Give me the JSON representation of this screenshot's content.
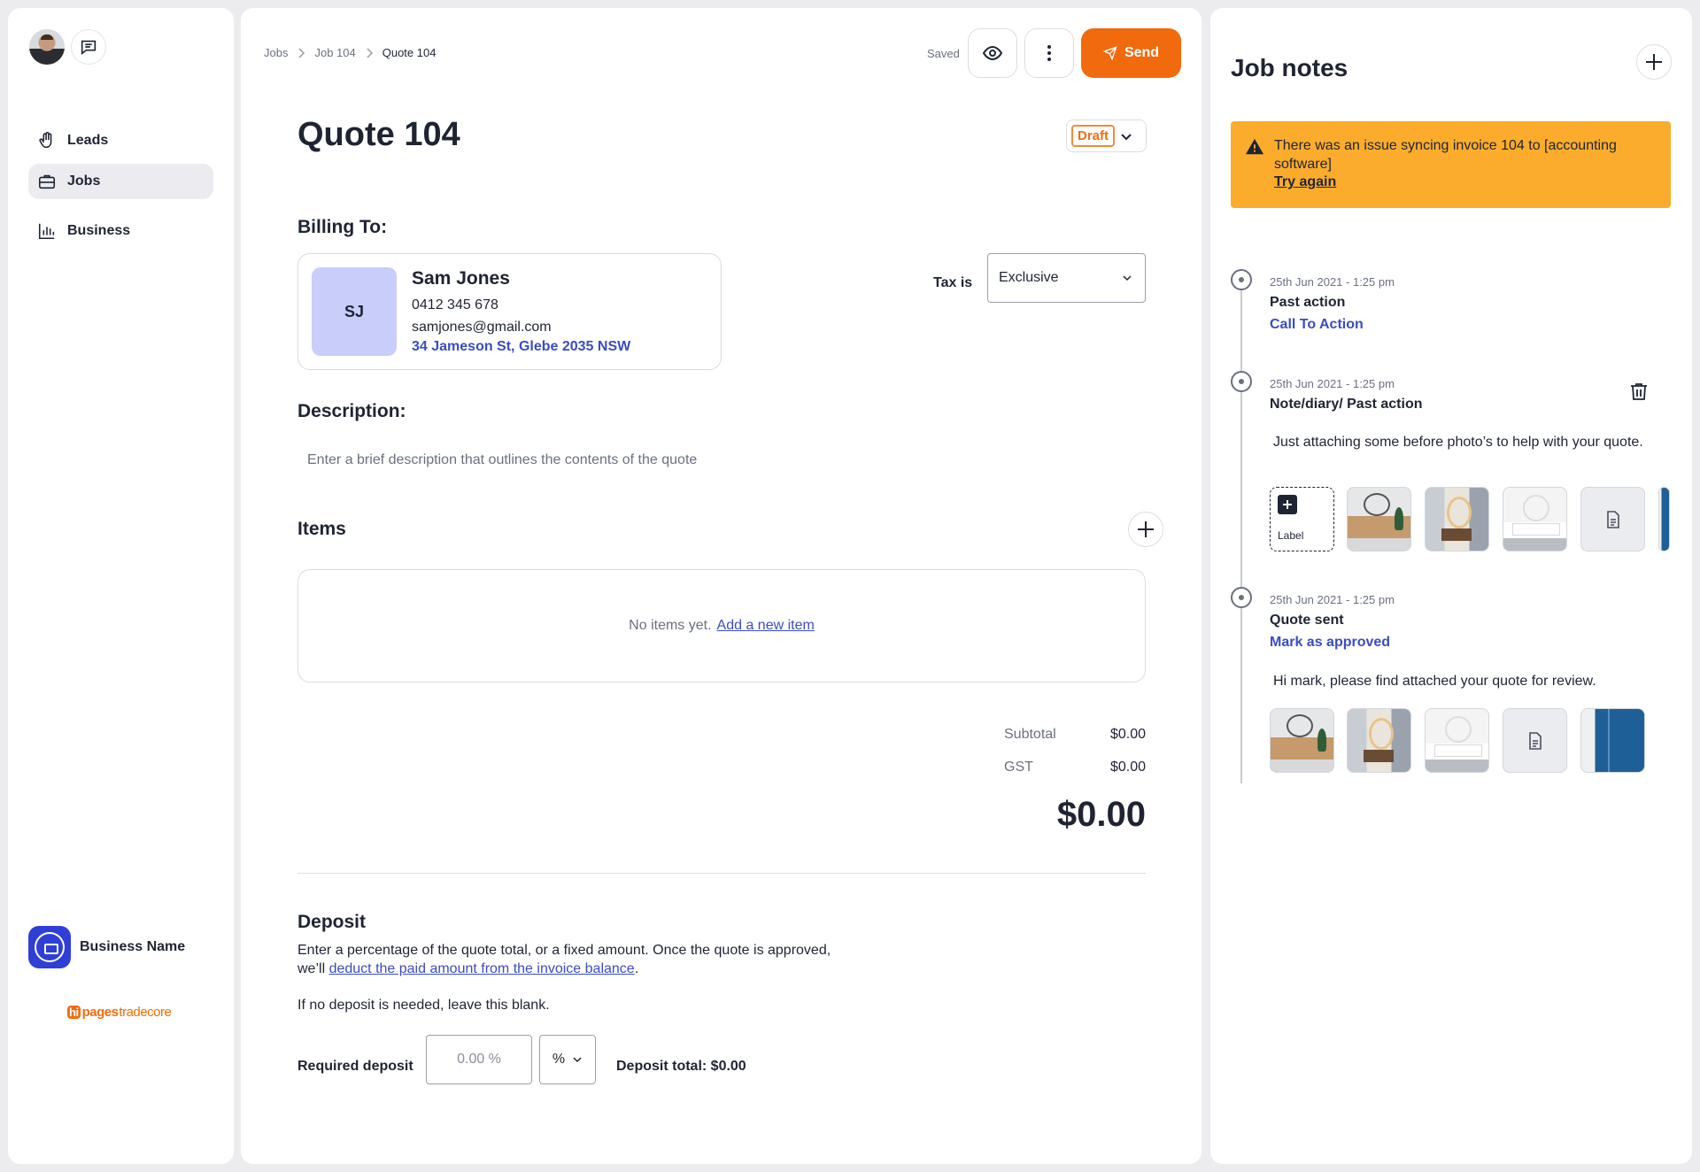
{
  "sidebar": {
    "nav": [
      {
        "label": "Leads",
        "icon": "hand-icon"
      },
      {
        "label": "Jobs",
        "icon": "briefcase-icon"
      },
      {
        "label": "Business",
        "icon": "bar-chart-icon"
      }
    ],
    "business_name": "Business Name",
    "brand": {
      "hi": "hi",
      "pages": "pages",
      "tradecore": "tradecore"
    }
  },
  "header": {
    "breadcrumbs": [
      "Jobs",
      "Job 104",
      "Quote 104"
    ],
    "saved": "Saved",
    "send_label": "Send"
  },
  "quote": {
    "title": "Quote 104",
    "status": "Draft",
    "billing_heading": "Billing To:",
    "client": {
      "initials": "SJ",
      "name": "Sam Jones",
      "phone": "0412 345 678",
      "email": "samjones@gmail.com",
      "address": "34 Jameson St, Glebe 2035 NSW"
    },
    "tax_label": "Tax is",
    "tax_value": "Exclusive",
    "description_heading": "Description:",
    "description_placeholder": "Enter a brief description that outlines the contents of the quote",
    "items_heading": "Items",
    "items_empty": "No items yet.",
    "items_add_link": "Add a new item",
    "subtotal_label": "Subtotal",
    "subtotal_value": "$0.00",
    "gst_label": "GST",
    "gst_value": "$0.00",
    "total": "$0.00",
    "deposit": {
      "heading": "Deposit",
      "text1": "Enter a percentage of the quote total, or a fixed amount. Once the quote is approved,",
      "text2_prefix": "we’ll",
      "text2_link": "deduct the paid amount from the invoice balance",
      "text2_suffix": ".",
      "text3": "If no deposit is needed, leave this blank.",
      "label": "Required deposit",
      "placeholder": "0.00 %",
      "unit": "%",
      "total": "Deposit total: $0.00"
    }
  },
  "notes": {
    "title": "Job notes",
    "alert_text": "There was an issue syncing invoice 104 to [accounting software]",
    "alert_link": "Try again",
    "entries": [
      {
        "date": "25th Jun 2021 - 1:25 pm",
        "title": "Past action",
        "cta": "Call To  Action"
      },
      {
        "date": "25th Jun 2021 - 1:25 pm",
        "title": "Note/diary/ Past action",
        "body": "Just attaching some before photo’s to help with your quote.",
        "add_label": "Label"
      },
      {
        "date": "25th Jun 2021 - 1:25 pm",
        "title": "Quote sent",
        "cta": "Mark as approved",
        "body": "Hi mark, please find attached your quote for review."
      }
    ]
  }
}
